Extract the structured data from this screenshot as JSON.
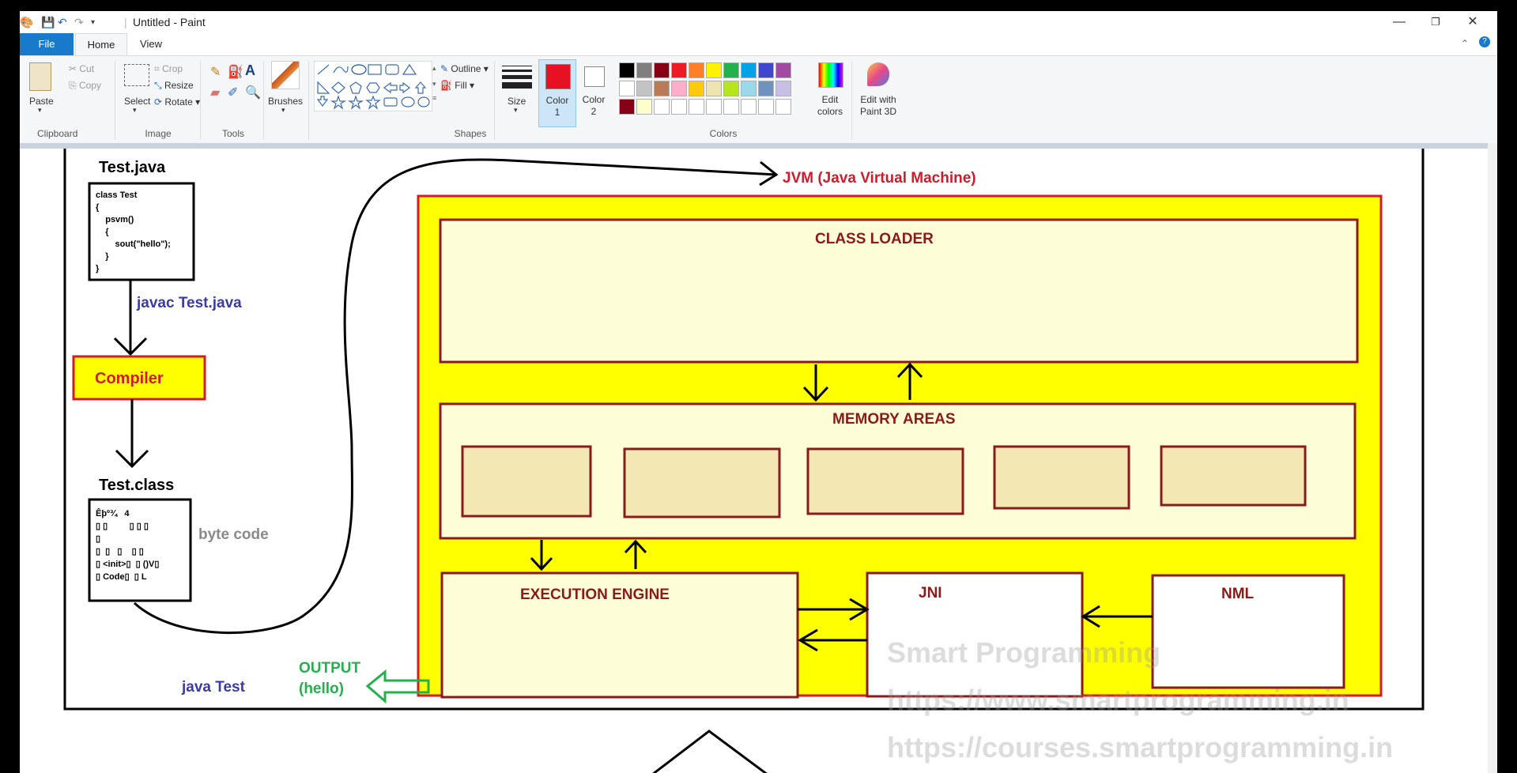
{
  "titlebar": {
    "title": "Untitled - Paint",
    "minimize_glyph": "—",
    "maximize_glyph": "❐",
    "close_glyph": "✕"
  },
  "tabs": {
    "file": "File",
    "home": "Home",
    "view": "View"
  },
  "ribbon": {
    "clipboard": {
      "paste": "Paste",
      "cut": "Cut",
      "copy": "Copy",
      "group": "Clipboard"
    },
    "image": {
      "select": "Select",
      "crop": "Crop",
      "resize": "Resize",
      "rotate": "Rotate",
      "group": "Image"
    },
    "tools": {
      "group": "Tools"
    },
    "brushes": {
      "label": "Brushes"
    },
    "shapes": {
      "outline": "Outline",
      "fill": "Fill",
      "group": "Shapes"
    },
    "size": {
      "label": "Size"
    },
    "color1": {
      "label_line1": "Color",
      "label_line2": "1",
      "value": "#e81123"
    },
    "color2": {
      "label_line1": "Color",
      "label_line2": "2",
      "value": "#ffffff"
    },
    "edit_colors": {
      "line1": "Edit",
      "line2": "colors"
    },
    "edit_3d": {
      "line1": "Edit with",
      "line2": "Paint 3D"
    },
    "colors_group": "Colors",
    "palette_row1": [
      "#000000",
      "#7f7f7f",
      "#880015",
      "#ed1c24",
      "#ff7f27",
      "#fff200",
      "#22b14c",
      "#00a2e8",
      "#3f48cc",
      "#a349a4"
    ],
    "palette_row2": [
      "#ffffff",
      "#c3c3c3",
      "#b97a57",
      "#ffaec9",
      "#ffc90e",
      "#efe4b0",
      "#b5e61d",
      "#99d9ea",
      "#7092be",
      "#c8bfe7"
    ],
    "palette_row3": [
      "#880015",
      "#fefecc",
      "#ffffff",
      "#ffffff",
      "#ffffff",
      "#ffffff",
      "#ffffff",
      "#ffffff",
      "#ffffff",
      "#ffffff"
    ]
  },
  "drawing": {
    "test_java_title": "Test.java",
    "code_lines": [
      "class Test",
      "{",
      "    psvm()",
      "    {",
      "        sout(\"hello\");",
      "    }",
      "}"
    ],
    "javac_label": "javac Test.java",
    "compiler": "Compiler",
    "test_class_title": "Test.class",
    "bytecode_lines": [
      "Êþº¾   4",
      "▯ ▯         ▯ ▯ ▯",
      "▯",
      "▯  ▯   ▯    ▯ ▯",
      "▯ <init>▯  ▯ ()V▯",
      "▯ Code▯  ▯ L"
    ],
    "byte_code_label": "byte code",
    "java_test_label": "java Test",
    "output_line1": "OUTPUT",
    "output_line2": "(hello)",
    "jvm_label": "JVM (Java Virtual Machine)",
    "class_loader": "CLASS LOADER",
    "memory_areas": "MEMORY AREAS",
    "execution_engine": "EXECUTION ENGINE",
    "jni": "JNI",
    "nml": "NML",
    "watermark_1": "Smart Programming",
    "watermark_2": "https://www.smartprogramming.in",
    "watermark_3": "https://courses.smartprogramming.in"
  }
}
